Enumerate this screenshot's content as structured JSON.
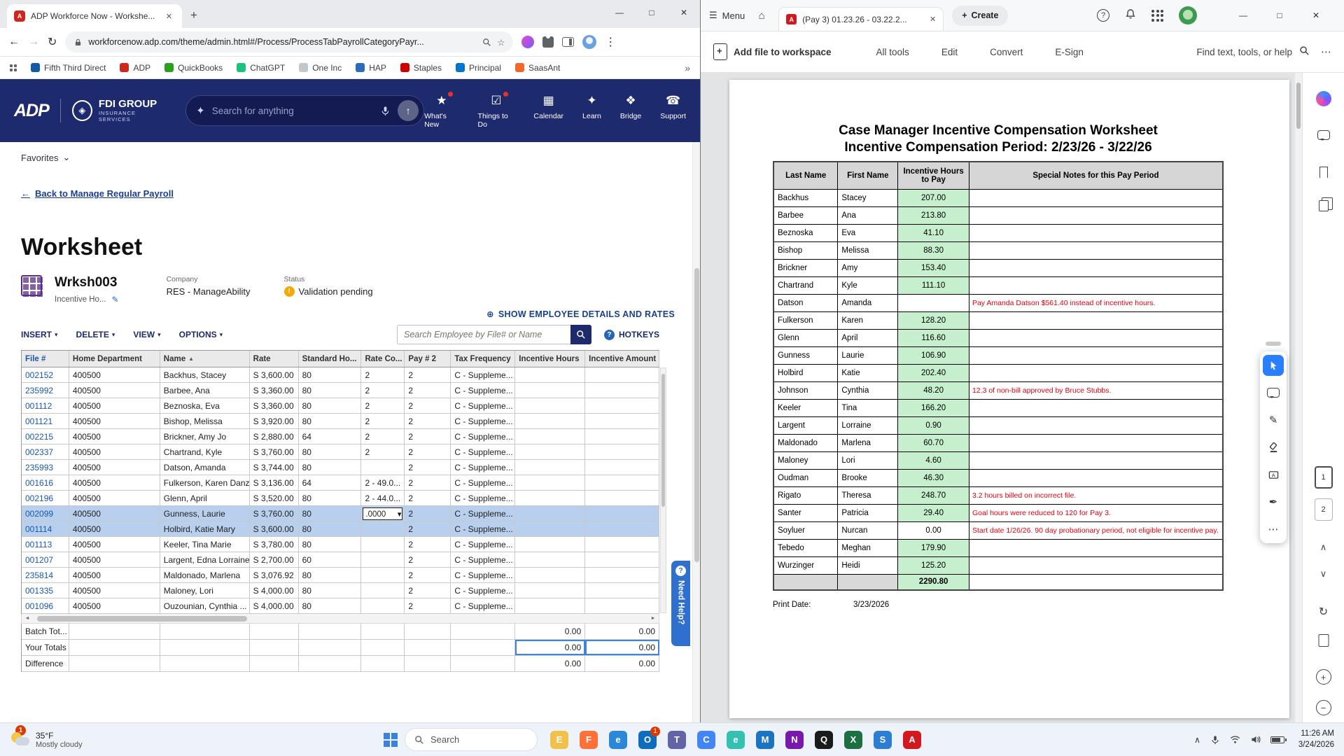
{
  "colors": {
    "adp_navy": "#1e2a6e",
    "link_blue": "#1a56b0",
    "selected_row_blue": "#b8cfed",
    "pdf_hours_green": "#c6efce",
    "pdf_note_red": "#e4000f",
    "need_help_blue": "#2f6fce",
    "acrobat_select_blue": "#2a7fff",
    "warning_orange": "#f5a800"
  },
  "glyphs": {
    "back": "←",
    "forward": "→",
    "refresh": "↻",
    "minimize": "—",
    "maximize": "□",
    "close": "✕",
    "new_tab": "+",
    "kebab": "⋮",
    "ellipsis": "⋯",
    "caret_down": "▾",
    "chevron_down": "⌄",
    "sort_asc": "▲",
    "plus_circle": "⊕",
    "hamburger": "☰",
    "home": "⌂",
    "star": "☆",
    "bookmarks_overflow": "»",
    "scroll_left": "◄",
    "scroll_right": "►",
    "chevron_up": "∧",
    "chevron_down_small": "∨",
    "question": "?",
    "up_arrow": "↑",
    "sparkle": "✦",
    "pencil": "✎",
    "warning_mark": "!",
    "draw_pen": "✎",
    "sign_pen": "✒",
    "zoom_in": "+",
    "zoom_out": "−",
    "plus": "+",
    "letter_a": "A",
    "refresh2": "↻"
  },
  "icons": {
    "search": "magnifier-svg",
    "mic": "mic-svg",
    "lock": "padlock-svg",
    "wifi": "wifi-svg",
    "volume": "volume-svg",
    "battery": "css-battery",
    "select-tool": "cursor-arrow-svg",
    "bell": "bell-svg"
  },
  "browser": {
    "tab_title": "ADP Workforce Now - Workshe...",
    "url": "workforcenow.adp.com/theme/admin.html#/Process/ProcessTabPayrollCategoryPayr...",
    "bookmarks": [
      {
        "label": "Fifth Third Direct",
        "color": "#1459a4"
      },
      {
        "label": "ADP",
        "color": "#d0271d"
      },
      {
        "label": "QuickBooks",
        "color": "#2ca01c"
      },
      {
        "label": "ChatGPT",
        "color": "#19c37d"
      },
      {
        "label": "One Inc",
        "color": "#c2c7cc"
      },
      {
        "label": "HAP",
        "color": "#2b6cb8"
      },
      {
        "label": "Staples",
        "color": "#cc0000"
      },
      {
        "label": "Principal",
        "color": "#0076cf"
      },
      {
        "label": "SaasAnt",
        "color": "#f2672a"
      }
    ]
  },
  "adp": {
    "brand": "ADP",
    "partner_name": "FDI GROUP",
    "partner_sub": "INSURANCE SERVICES",
    "search_placeholder": "Search for anything",
    "nav": [
      {
        "label": "What's New",
        "icon": "whats-new",
        "badge": true
      },
      {
        "label": "Things to Do",
        "icon": "things-to-do",
        "badge": true
      },
      {
        "label": "Calendar",
        "icon": "calendar",
        "badge": false
      },
      {
        "label": "Learn",
        "icon": "learn",
        "badge": false
      },
      {
        "label": "Bridge",
        "icon": "bridge",
        "badge": false
      },
      {
        "label": "Support",
        "icon": "support",
        "badge": false
      }
    ],
    "favorites_label": "Favorites",
    "back_link": "Back to Manage Regular Payroll",
    "page_title": "Worksheet",
    "worksheet_id": "Wrksh003",
    "worksheet_name": "Incentive Ho...",
    "company_label": "Company",
    "company_value": "RES - ManageAbility",
    "status_label": "Status",
    "status_value": "Validation pending",
    "show_details_link": "SHOW EMPLOYEE DETAILS AND RATES",
    "menus": [
      {
        "label": "INSERT"
      },
      {
        "label": "DELETE"
      },
      {
        "label": "VIEW"
      },
      {
        "label": "OPTIONS"
      }
    ],
    "employee_search_placeholder": "Search Employee by File# or Name",
    "hotkeys_label": "HOTKEYS",
    "grid": {
      "columns": [
        "File #",
        "Home Department",
        "Name",
        "Rate",
        "Standard Ho...",
        "Rate Co...",
        "Pay # 2",
        "Tax Frequency",
        "Incentive Hours",
        "Incentive Amount"
      ],
      "rows": [
        {
          "file": "002152",
          "dept": "400500",
          "name": "Backhus, Stacey",
          "rate": "S 3,600.00",
          "std": "80",
          "rateco": "2",
          "pay2": "2",
          "tax": "C - Suppleme...",
          "sel": false,
          "dd": false
        },
        {
          "file": "235992",
          "dept": "400500",
          "name": "Barbee, Ana",
          "rate": "S 3,360.00",
          "std": "80",
          "rateco": "2",
          "pay2": "2",
          "tax": "C - Suppleme...",
          "sel": false,
          "dd": false
        },
        {
          "file": "001112",
          "dept": "400500",
          "name": "Beznoska, Eva",
          "rate": "S 3,360.00",
          "std": "80",
          "rateco": "2",
          "pay2": "2",
          "tax": "C - Suppleme...",
          "sel": false,
          "dd": false
        },
        {
          "file": "001121",
          "dept": "400500",
          "name": "Bishop, Melissa",
          "rate": "S 3,920.00",
          "std": "80",
          "rateco": "2",
          "pay2": "2",
          "tax": "C - Suppleme...",
          "sel": false,
          "dd": false
        },
        {
          "file": "002215",
          "dept": "400500",
          "name": "Brickner, Amy Jo",
          "rate": "S 2,880.00",
          "std": "64",
          "rateco": "2",
          "pay2": "2",
          "tax": "C - Suppleme...",
          "sel": false,
          "dd": false
        },
        {
          "file": "002337",
          "dept": "400500",
          "name": "Chartrand, Kyle",
          "rate": "S 3,760.00",
          "std": "80",
          "rateco": "2",
          "pay2": "2",
          "tax": "C - Suppleme...",
          "sel": false,
          "dd": false
        },
        {
          "file": "235993",
          "dept": "400500",
          "name": "Datson, Amanda",
          "rate": "S 3,744.00",
          "std": "80",
          "rateco": "",
          "pay2": "2",
          "tax": "C - Suppleme...",
          "sel": false,
          "dd": false
        },
        {
          "file": "001616",
          "dept": "400500",
          "name": "Fulkerson, Karen Danz",
          "rate": "S 3,136.00",
          "std": "64",
          "rateco": "2 - 49.0...",
          "pay2": "2",
          "tax": "C - Suppleme...",
          "sel": false,
          "dd": false
        },
        {
          "file": "002196",
          "dept": "400500",
          "name": "Glenn, April",
          "rate": "S 3,520.00",
          "std": "80",
          "rateco": "2 - 44.0...",
          "pay2": "2",
          "tax": "C - Suppleme...",
          "sel": false,
          "dd": false
        },
        {
          "file": "002099",
          "dept": "400500",
          "name": "Gunness, Laurie",
          "rate": "S 3,760.00",
          "std": "80",
          "rateco": ".0000",
          "pay2": "2",
          "tax": "C - Suppleme...",
          "sel": true,
          "dd": true
        },
        {
          "file": "001114",
          "dept": "400500",
          "name": "Holbird, Katie Mary",
          "rate": "S 3,600.00",
          "std": "80",
          "rateco": "",
          "pay2": "2",
          "tax": "C - Suppleme...",
          "sel": true,
          "dd": false
        },
        {
          "file": "001113",
          "dept": "400500",
          "name": "Keeler, Tina Marie",
          "rate": "S 3,780.00",
          "std": "80",
          "rateco": "",
          "pay2": "2",
          "tax": "C - Suppleme...",
          "sel": false,
          "dd": false
        },
        {
          "file": "001207",
          "dept": "400500",
          "name": "Largent, Edna Lorraine",
          "rate": "S 2,700.00",
          "std": "60",
          "rateco": "",
          "pay2": "2",
          "tax": "C - Suppleme...",
          "sel": false,
          "dd": false
        },
        {
          "file": "235814",
          "dept": "400500",
          "name": "Maldonado, Marlena",
          "rate": "S 3,076.92",
          "std": "80",
          "rateco": "",
          "pay2": "2",
          "tax": "C - Suppleme...",
          "sel": false,
          "dd": false
        },
        {
          "file": "001335",
          "dept": "400500",
          "name": "Maloney, Lori",
          "rate": "S 4,000.00",
          "std": "80",
          "rateco": "",
          "pay2": "2",
          "tax": "C - Suppleme...",
          "sel": false,
          "dd": false
        },
        {
          "file": "001096",
          "dept": "400500",
          "name": "Ouzounian, Cynthia ...",
          "rate": "S 4,000.00",
          "std": "80",
          "rateco": "",
          "pay2": "2",
          "tax": "C - Suppleme...",
          "sel": false,
          "dd": false
        }
      ],
      "totals": [
        {
          "label": "Batch Tot...",
          "hours": "0.00",
          "amount": "0.00",
          "focus": false
        },
        {
          "label": "Your Totals",
          "hours": "0.00",
          "amount": "0.00",
          "focus": true
        },
        {
          "label": "Difference",
          "hours": "0.00",
          "amount": "0.00",
          "focus": false
        }
      ]
    },
    "need_help": "Need Help?"
  },
  "acrobat": {
    "menu_label": "Menu",
    "tab_title": "(Pay 3) 01.23.26 - 03.22.2...",
    "create_label": "Create",
    "add_file_label": "Add file to workspace",
    "center_tools": [
      {
        "label": "All tools"
      },
      {
        "label": "Edit"
      },
      {
        "label": "Convert"
      },
      {
        "label": "E-Sign"
      }
    ],
    "find_label": "Find text, tools, or help",
    "page_numbers": [
      "1",
      "2"
    ]
  },
  "pdf": {
    "title": "Case Manager Incentive Compensation Worksheet",
    "subtitle": "Incentive Compensation Period: 2/23/26 - 3/22/26",
    "columns": [
      "Last Name",
      "First Name",
      "Incentive Hours to Pay",
      "Special Notes for this Pay Period"
    ],
    "rows": [
      {
        "last": "Backhus",
        "first": "Stacey",
        "hours": "207.00",
        "note": "",
        "green": true,
        "tall": false
      },
      {
        "last": "Barbee",
        "first": "Ana",
        "hours": "213.80",
        "note": "",
        "green": true,
        "tall": false
      },
      {
        "last": "Beznoska",
        "first": "Eva",
        "hours": "41.10",
        "note": "",
        "green": true,
        "tall": false
      },
      {
        "last": "Bishop",
        "first": "Melissa",
        "hours": "88.30",
        "note": "",
        "green": true,
        "tall": false
      },
      {
        "last": "Brickner",
        "first": "Amy",
        "hours": "153.40",
        "note": "",
        "green": true,
        "tall": false
      },
      {
        "last": "Chartrand",
        "first": "Kyle",
        "hours": "111.10",
        "note": "",
        "green": true,
        "tall": false
      },
      {
        "last": "Datson",
        "first": "Amanda",
        "hours": "",
        "note": "Pay Amanda Datson $561.40 instead of incentive hours.",
        "green": false,
        "tall": false
      },
      {
        "last": "Fulkerson",
        "first": "Karen",
        "hours": "128.20",
        "note": "",
        "green": true,
        "tall": false
      },
      {
        "last": "Glenn",
        "first": "April",
        "hours": "116.60",
        "note": "",
        "green": true,
        "tall": false
      },
      {
        "last": "Gunness",
        "first": "Laurie",
        "hours": "106.90",
        "note": "",
        "green": true,
        "tall": false
      },
      {
        "last": "Holbird",
        "first": "Katie",
        "hours": "202.40",
        "note": "",
        "green": true,
        "tall": false
      },
      {
        "last": "Johnson",
        "first": "Cynthia",
        "hours": "48.20",
        "note": "12.3 of non-bill approved by Bruce Stubbs.",
        "green": true,
        "tall": false
      },
      {
        "last": "Keeler",
        "first": "Tina",
        "hours": "166.20",
        "note": "",
        "green": true,
        "tall": false
      },
      {
        "last": "Largent",
        "first": "Lorraine",
        "hours": "0.90",
        "note": "",
        "green": true,
        "tall": false
      },
      {
        "last": "Maldonado",
        "first": "Marlena",
        "hours": "60.70",
        "note": "",
        "green": true,
        "tall": false
      },
      {
        "last": "Maloney",
        "first": "Lori",
        "hours": "4.60",
        "note": "",
        "green": true,
        "tall": false
      },
      {
        "last": "Oudman",
        "first": "Brooke",
        "hours": "46.30",
        "note": "",
        "green": true,
        "tall": false
      },
      {
        "last": "Rigato",
        "first": "Theresa",
        "hours": "248.70",
        "note": "3.2 hours billed on incorrect file.",
        "green": true,
        "tall": false
      },
      {
        "last": "Santer",
        "first": "Patricia",
        "hours": "29.40",
        "note": "Goal hours were reduced to 120 for Pay 3.",
        "green": true,
        "tall": false
      },
      {
        "last": "Soyluer",
        "first": "Nurcan",
        "hours": "0.00",
        "note": "Start date 1/26/26. 90 day probationary period, not eligible for incentive pay.",
        "green": false,
        "tall": true
      },
      {
        "last": "Tebedo",
        "first": "Meghan",
        "hours": "179.90",
        "note": "",
        "green": true,
        "tall": false
      },
      {
        "last": "Wurzinger",
        "first": "Heidi",
        "hours": "125.20",
        "note": "",
        "green": true,
        "tall": false
      }
    ],
    "total_hours": "2290.80",
    "print_date_label": "Print Date:",
    "print_date_value": "3/23/2026"
  },
  "taskbar": {
    "weather_badge": "1",
    "weather_temp": "35°F",
    "weather_desc": "Mostly cloudy",
    "search_placeholder": "Search",
    "apps": [
      {
        "name": "file-explorer",
        "glyph": "E",
        "color": "#f2c14b",
        "badge": ""
      },
      {
        "name": "firefox",
        "glyph": "F",
        "color": "#ff7139",
        "badge": ""
      },
      {
        "name": "edge",
        "glyph": "e",
        "color": "#2b88d8",
        "badge": ""
      },
      {
        "name": "outlook",
        "glyph": "O",
        "color": "#0f6cbd",
        "badge": "1"
      },
      {
        "name": "teams",
        "glyph": "T",
        "color": "#6264a7",
        "badge": ""
      },
      {
        "name": "chrome",
        "glyph": "C",
        "color": "#4285f4",
        "badge": ""
      },
      {
        "name": "edge-dev",
        "glyph": "e",
        "color": "#35c1b2",
        "badge": ""
      },
      {
        "name": "mail",
        "glyph": "M",
        "color": "#1b74c2",
        "badge": ""
      },
      {
        "name": "onenote",
        "glyph": "N",
        "color": "#7719aa",
        "badge": ""
      },
      {
        "name": "app-q",
        "glyph": "Q",
        "color": "#1b1b1b",
        "badge": ""
      },
      {
        "name": "excel",
        "glyph": "X",
        "color": "#1d6f42",
        "badge": ""
      },
      {
        "name": "store",
        "glyph": "S",
        "color": "#2d7dd2",
        "badge": ""
      },
      {
        "name": "acrobat",
        "glyph": "A",
        "color": "#d1191f",
        "badge": ""
      }
    ],
    "time": "11:26 AM",
    "date": "3/24/2026"
  }
}
